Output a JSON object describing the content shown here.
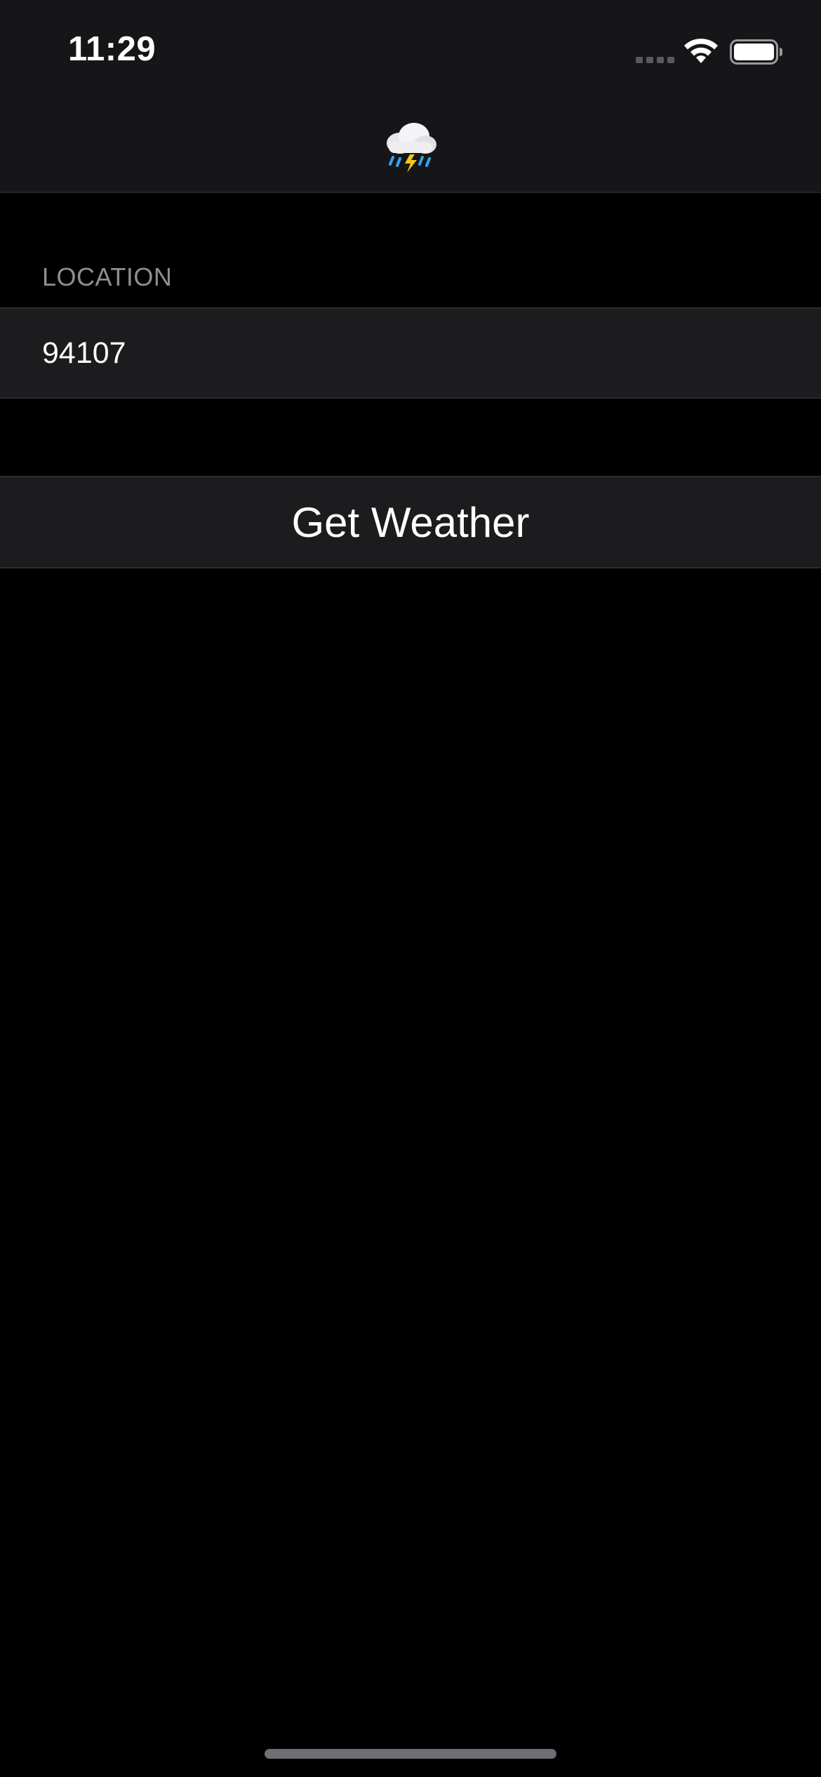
{
  "status_bar": {
    "time": "11:29",
    "signal_icon": "cellular-signal-icon",
    "wifi_icon": "wifi-icon",
    "battery_icon": "battery-icon"
  },
  "navigation": {
    "title_icon": "cloud-rain-lightning-emoji"
  },
  "form": {
    "section_header": "LOCATION",
    "location_value": "94107"
  },
  "actions": {
    "get_weather_label": "Get Weather"
  },
  "colors": {
    "background": "#000000",
    "bar_background": "#161618",
    "cell_background": "#1c1c1e",
    "secondary_text": "#8e8e93"
  }
}
